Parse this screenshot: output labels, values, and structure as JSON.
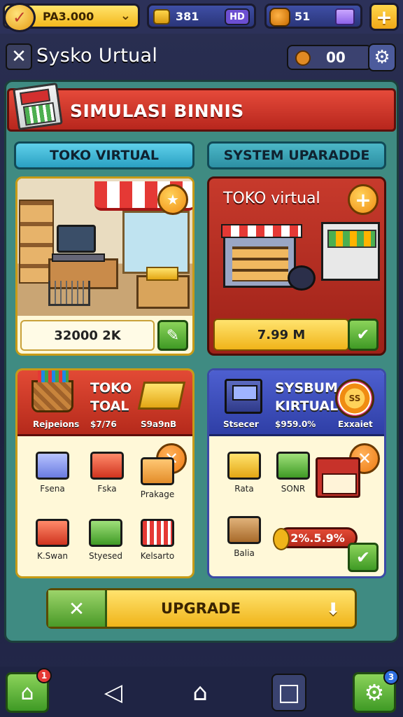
{
  "top_bar": {
    "money": "PA3.000",
    "coins": "381",
    "coins_tag": "HD",
    "gems": "51"
  },
  "header": {
    "title": "Sysko Urtual",
    "counter": "00"
  },
  "banner": {
    "title": "SIMULASI BINNIS"
  },
  "tabs": [
    {
      "label": "TOKO VIRTUAL"
    },
    {
      "label": "SYSTEM UPARADDE"
    }
  ],
  "shop_card": {
    "price": "32000 2K"
  },
  "upgrade_card": {
    "title": "TOKO virtual",
    "price": "7.99 M"
  },
  "toko_card": {
    "title_line1": "TOKO",
    "title_line2": "TOAL",
    "sub_left": "Rejpeions",
    "sub_mid": "$7/76",
    "sub_right": "S9a9nB",
    "items": [
      {
        "label": "Fsena",
        "icon": "mixer-icon"
      },
      {
        "label": "Fska",
        "icon": "register-box-icon"
      },
      {
        "label": "Prakage",
        "icon": "package-icon"
      },
      {
        "label": "K.Swan",
        "icon": "red-crate-icon"
      },
      {
        "label": "Styesed",
        "icon": "cash-stack-icon"
      },
      {
        "label": "Kelsarto",
        "icon": "shopping-cart-icon"
      }
    ]
  },
  "sys_card": {
    "title_line1": "SYSBUM",
    "title_line2": "KIRTUAL",
    "sub_left": "Stsecer",
    "sub_mid": "$959.0%",
    "sub_right": "Exxaiet",
    "medal": "SS",
    "items": [
      {
        "label": "Rata",
        "icon": "gold-bars-icon"
      },
      {
        "label": "SONR",
        "icon": "green-crates-icon"
      },
      {
        "label": "Balia",
        "icon": "box-dolly-icon"
      }
    ],
    "percent": "2%.5.9%"
  },
  "upgrade_button": {
    "label": "UPGRADE"
  },
  "nav": {
    "home_notif": "1",
    "settings_notif": "3"
  }
}
